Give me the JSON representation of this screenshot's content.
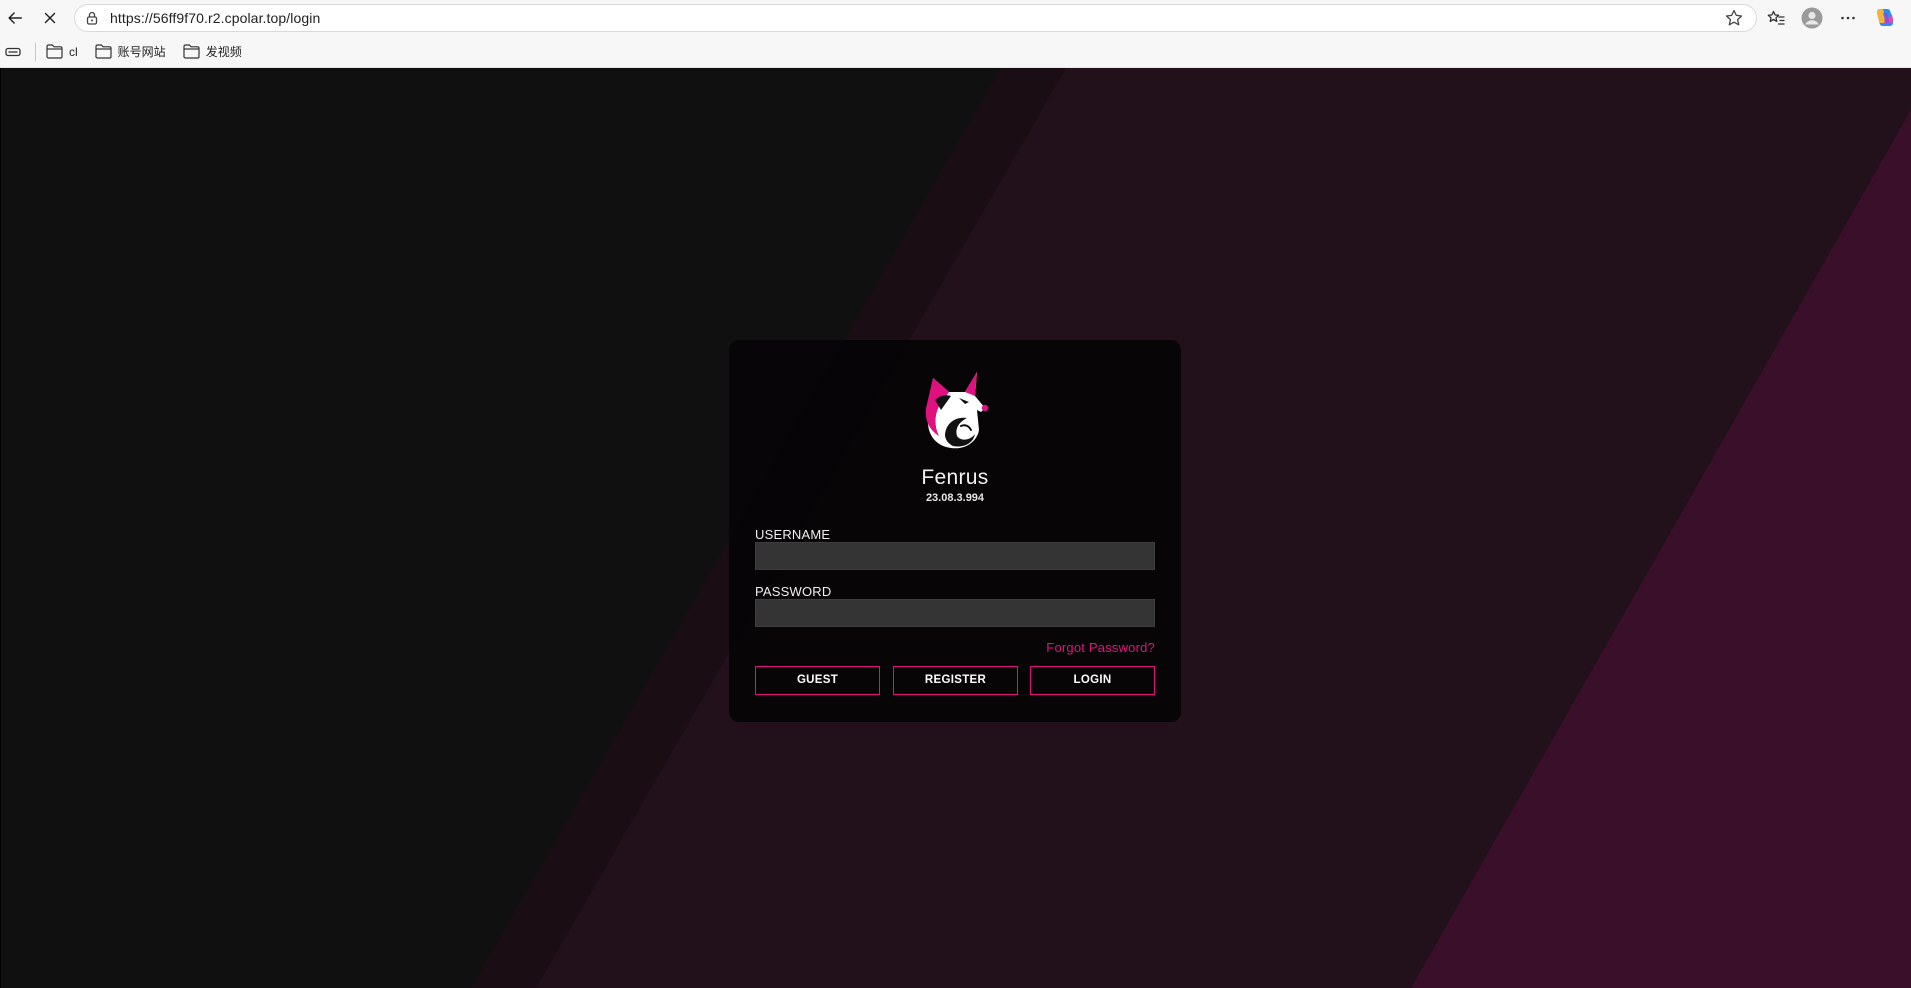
{
  "browser": {
    "url": "https://56ff9f70.r2.cpolar.top/login",
    "bookmarks": [
      {
        "label": "cl"
      },
      {
        "label": "账号网站"
      },
      {
        "label": "发视频"
      }
    ]
  },
  "login": {
    "app_name": "Fenrus",
    "version": "23.08.3.994",
    "username_label": "USERNAME",
    "username_value": "",
    "password_label": "PASSWORD",
    "password_value": "",
    "forgot_password": "Forgot Password?",
    "guest_button": "GUEST",
    "register_button": "REGISTER",
    "login_button": "LOGIN"
  },
  "colors": {
    "accent": "#e0117f",
    "background": "#101010",
    "card": "#060406",
    "input": "#343434"
  },
  "icons": [
    "back-arrow-icon",
    "stop-icon",
    "lock-icon",
    "star-icon",
    "favorites-icon",
    "profile-icon",
    "more-icon",
    "copilot-icon",
    "apps-icon",
    "folder-icon",
    "fox-logo-icon"
  ]
}
